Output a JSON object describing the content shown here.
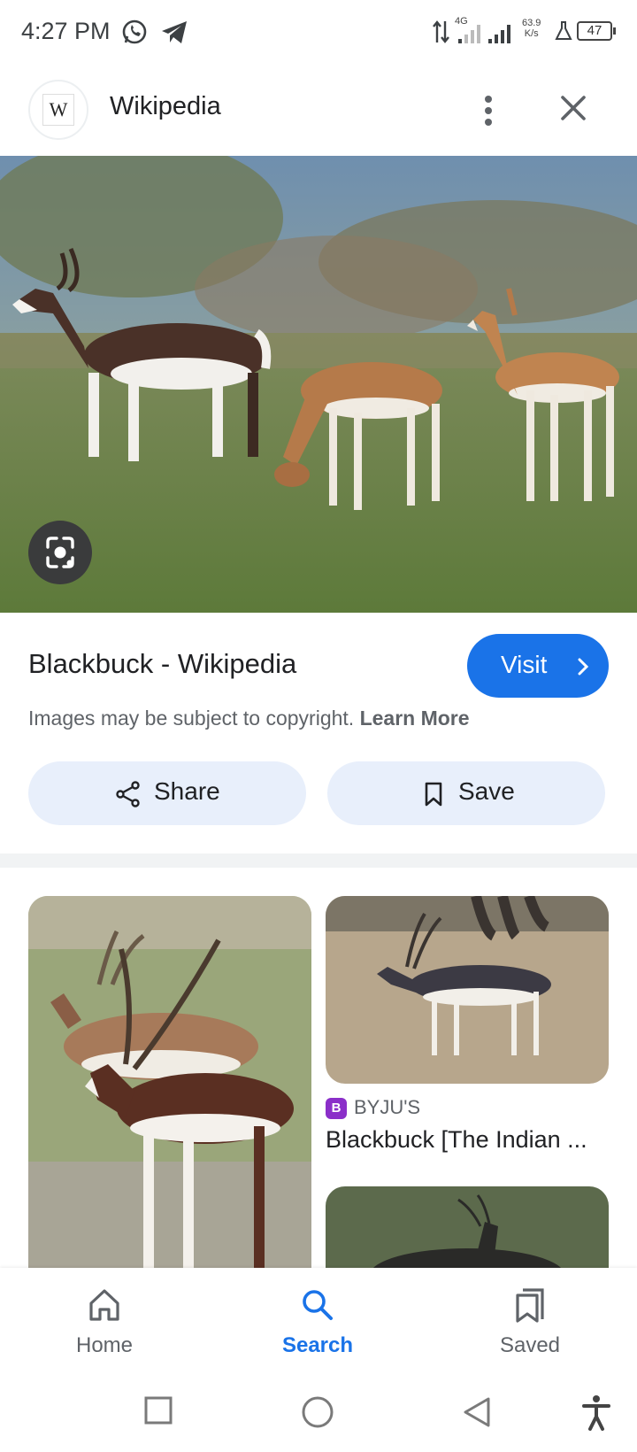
{
  "status_bar": {
    "time": "4:27 PM",
    "network": "4G",
    "speed_value": "63.9",
    "speed_unit": "K/s",
    "battery": "47"
  },
  "header": {
    "site_logo_letter": "W",
    "site_name": "Wikipedia",
    "more_icon": "more-vert-icon",
    "close_icon": "close-icon"
  },
  "result": {
    "title": "Blackbuck - Wikipedia",
    "visit_label": "Visit",
    "copyright_text": "Images may be subject to copyright.",
    "learn_more": "Learn More",
    "share_label": "Share",
    "save_label": "Save"
  },
  "related": [
    {
      "source_icon": "B",
      "source_name": "BYJU'S",
      "title": "Blackbuck [The Indian ..."
    }
  ],
  "bottom_nav": {
    "home": "Home",
    "search": "Search",
    "saved": "Saved"
  },
  "colors": {
    "accent": "#1a73e8",
    "pill_bg": "#e8effb",
    "secondary_text": "#5f6368"
  }
}
